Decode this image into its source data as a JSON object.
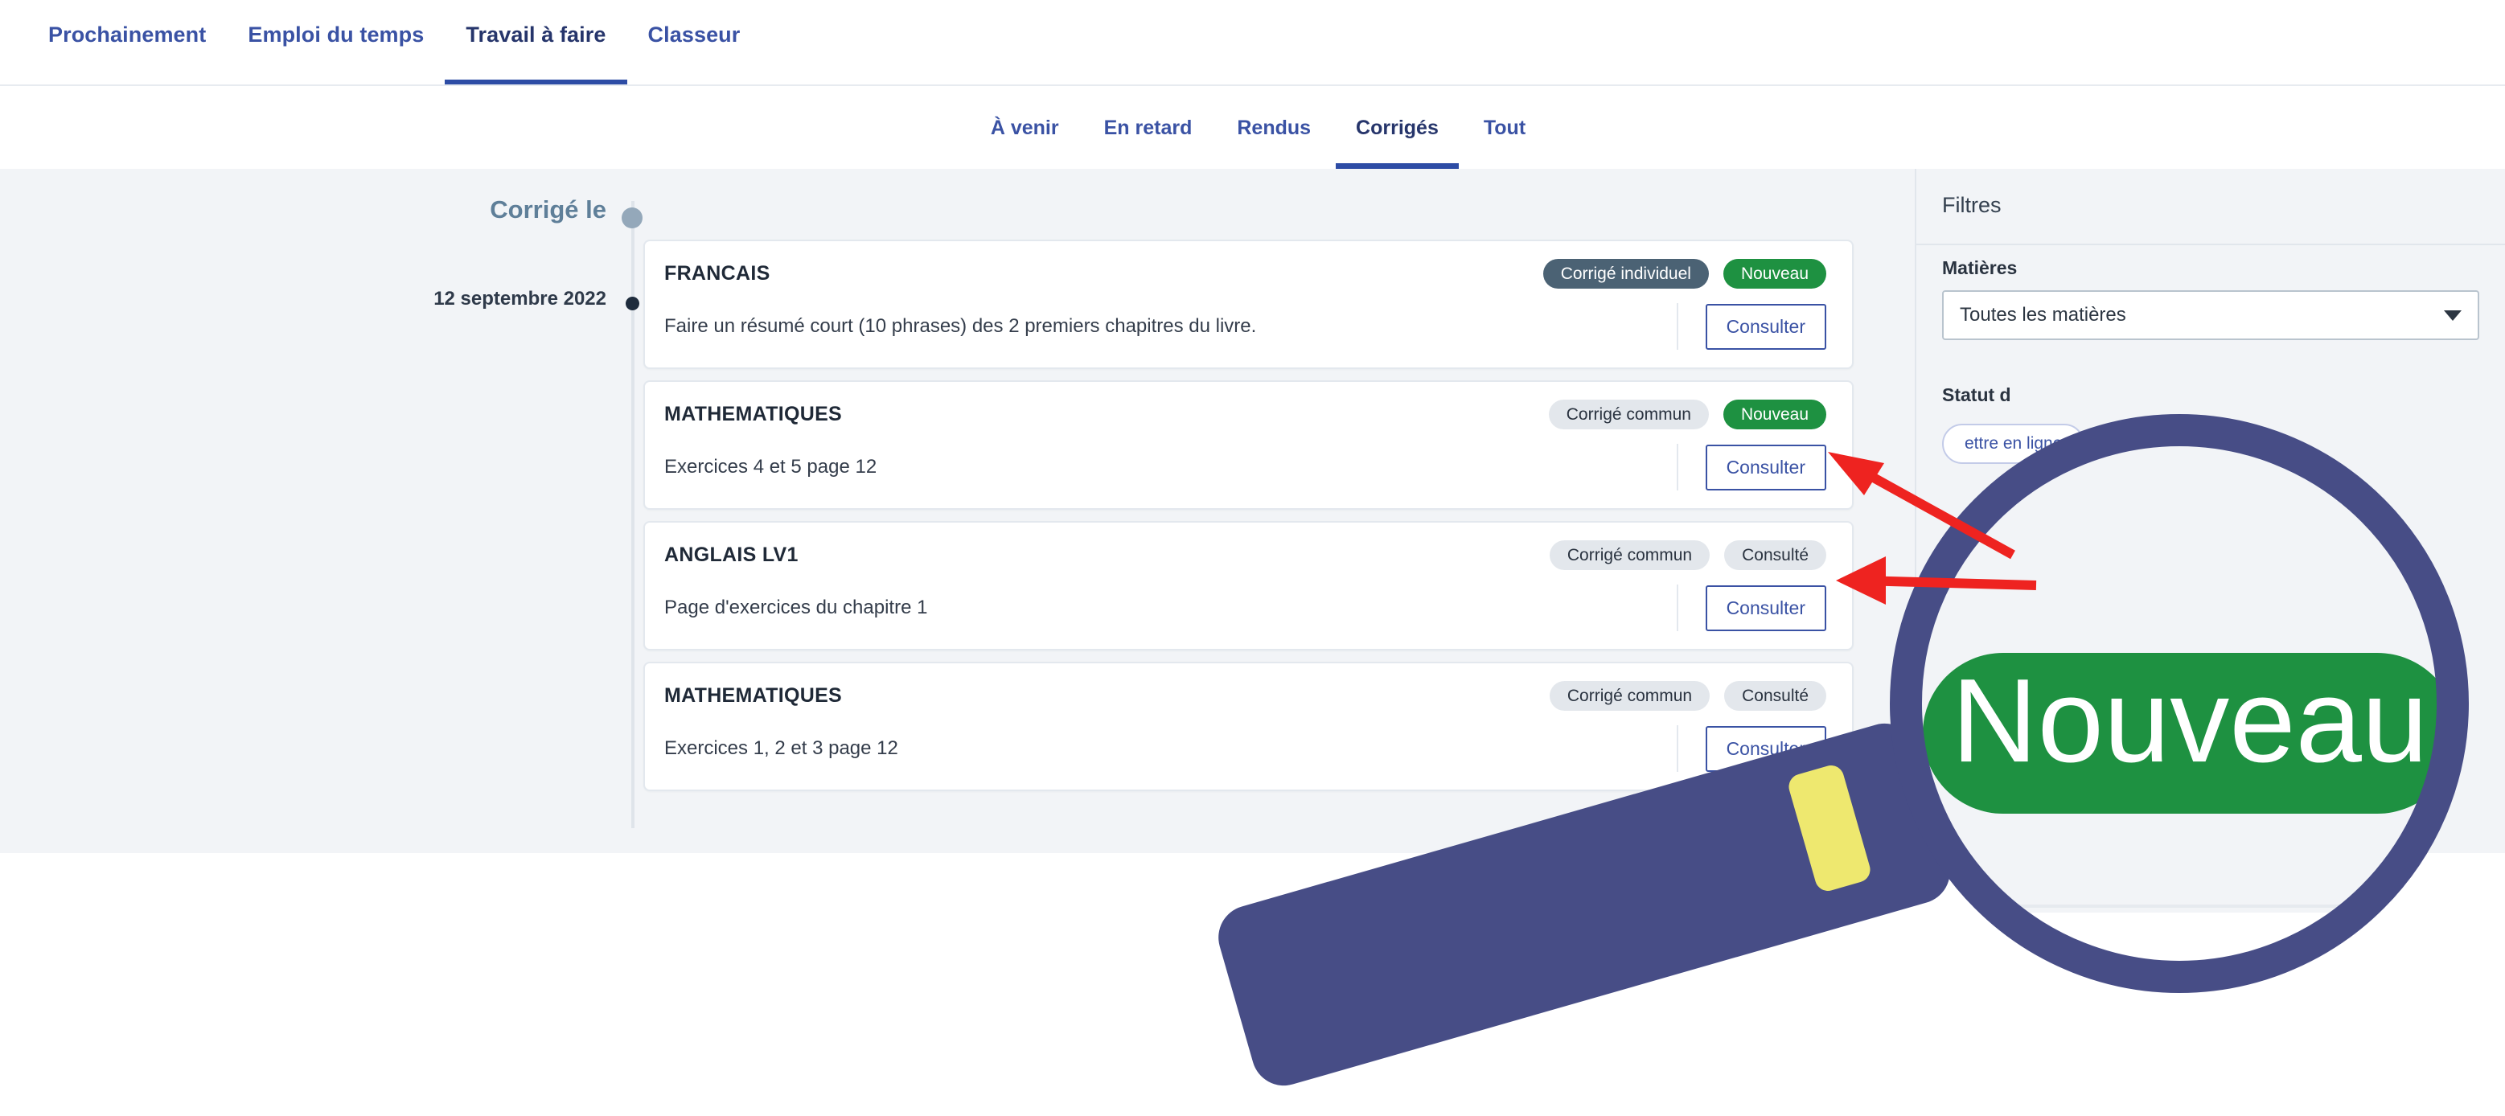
{
  "primary_nav": {
    "items": [
      {
        "label": "Prochainement",
        "active": false
      },
      {
        "label": "Emploi du temps",
        "active": false
      },
      {
        "label": "Travail à faire",
        "active": true
      },
      {
        "label": "Classeur",
        "active": false
      }
    ]
  },
  "secondary_nav": {
    "items": [
      {
        "label": "À venir",
        "active": false
      },
      {
        "label": "En retard",
        "active": false
      },
      {
        "label": "Rendus",
        "active": false
      },
      {
        "label": "Corrigés",
        "active": true
      },
      {
        "label": "Tout",
        "active": false
      }
    ]
  },
  "timeline": {
    "heading": "Corrigé le",
    "date": "12 septembre 2022"
  },
  "cards": [
    {
      "subject": "FRANCAIS",
      "description": "Faire un résumé court (10 phrases) des 2 premiers chapitres du livre.",
      "correction_badge": "Corrigé individuel",
      "correction_badge_type": "individual",
      "status_badge": "Nouveau",
      "status_badge_type": "new",
      "action_label": "Consulter"
    },
    {
      "subject": "MATHEMATIQUES",
      "description": "Exercices 4 et 5 page 12",
      "correction_badge": "Corrigé commun",
      "correction_badge_type": "commun",
      "status_badge": "Nouveau",
      "status_badge_type": "new",
      "action_label": "Consulter"
    },
    {
      "subject": "ANGLAIS LV1",
      "description": "Page d'exercices du chapitre 1",
      "correction_badge": "Corrigé commun",
      "correction_badge_type": "commun",
      "status_badge": "Consulté",
      "status_badge_type": "consulted",
      "action_label": "Consulter"
    },
    {
      "subject": "MATHEMATIQUES",
      "description": "Exercices 1, 2 et 3 page 12",
      "correction_badge": "Corrigé commun",
      "correction_badge_type": "commun",
      "status_badge": "Consulté",
      "status_badge_type": "consulted",
      "action_label": "Consulter"
    }
  ],
  "filters": {
    "title": "Filtres",
    "subject_label": "Matières",
    "subject_value": "Toutes les matières",
    "status_label": "Statut d",
    "status_pill": "ettre en ligne"
  },
  "annotation": {
    "magnified_badge": "Nouveau",
    "colors": {
      "accent_blue": "#3a52a4",
      "badge_new_green": "#1e9141",
      "badge_individual": "#4b6274",
      "badge_grey": "#e3e7ec",
      "magnifier_frame": "#474d86",
      "magnifier_band": "#eee86f",
      "arrow_red": "#ee2320",
      "page_grey": "#f2f4f7"
    }
  }
}
